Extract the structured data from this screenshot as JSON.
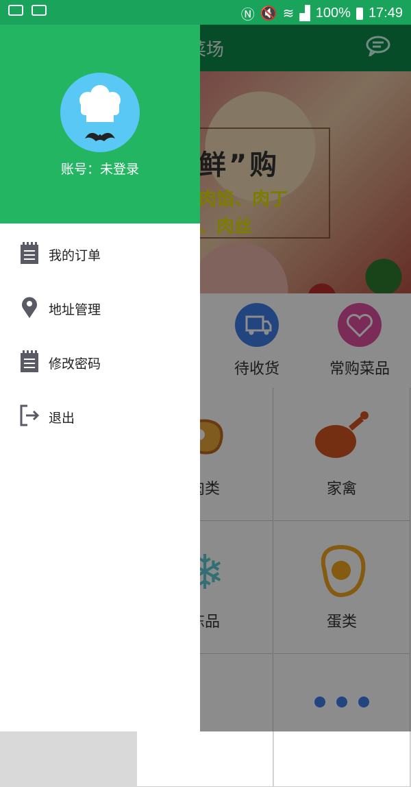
{
  "status_bar": {
    "battery": "100%",
    "time": "17:49"
  },
  "app": {
    "title": "菜场",
    "banner": {
      "headline": "鲜”购",
      "line1": "肉馅、肉丁",
      "line2": "、肉丝"
    },
    "quick_actions": [
      {
        "label": "待收货",
        "icon": "truck-clock-icon",
        "color": "#3f7fe8"
      },
      {
        "label": "常购菜品",
        "icon": "heart-icon",
        "color": "#e04fa0"
      }
    ],
    "categories": [
      {
        "label": "肉类",
        "icon": "meat-icon"
      },
      {
        "label": "家禽",
        "icon": "drumstick-icon"
      },
      {
        "label": "冻品",
        "icon": "snowflake-icon"
      },
      {
        "label": "蛋类",
        "icon": "egg-icon"
      }
    ]
  },
  "drawer": {
    "account_label": "账号：未登录",
    "menu": [
      {
        "label": "我的订单",
        "icon": "notepad-icon"
      },
      {
        "label": "地址管理",
        "icon": "location-pin-icon"
      },
      {
        "label": "修改密码",
        "icon": "notepad-icon"
      },
      {
        "label": "退出",
        "icon": "logout-icon"
      }
    ]
  },
  "colors": {
    "status_bar": "#1aa35a",
    "drawer_header": "#24b563",
    "avatar_bg": "#59c8f5"
  }
}
